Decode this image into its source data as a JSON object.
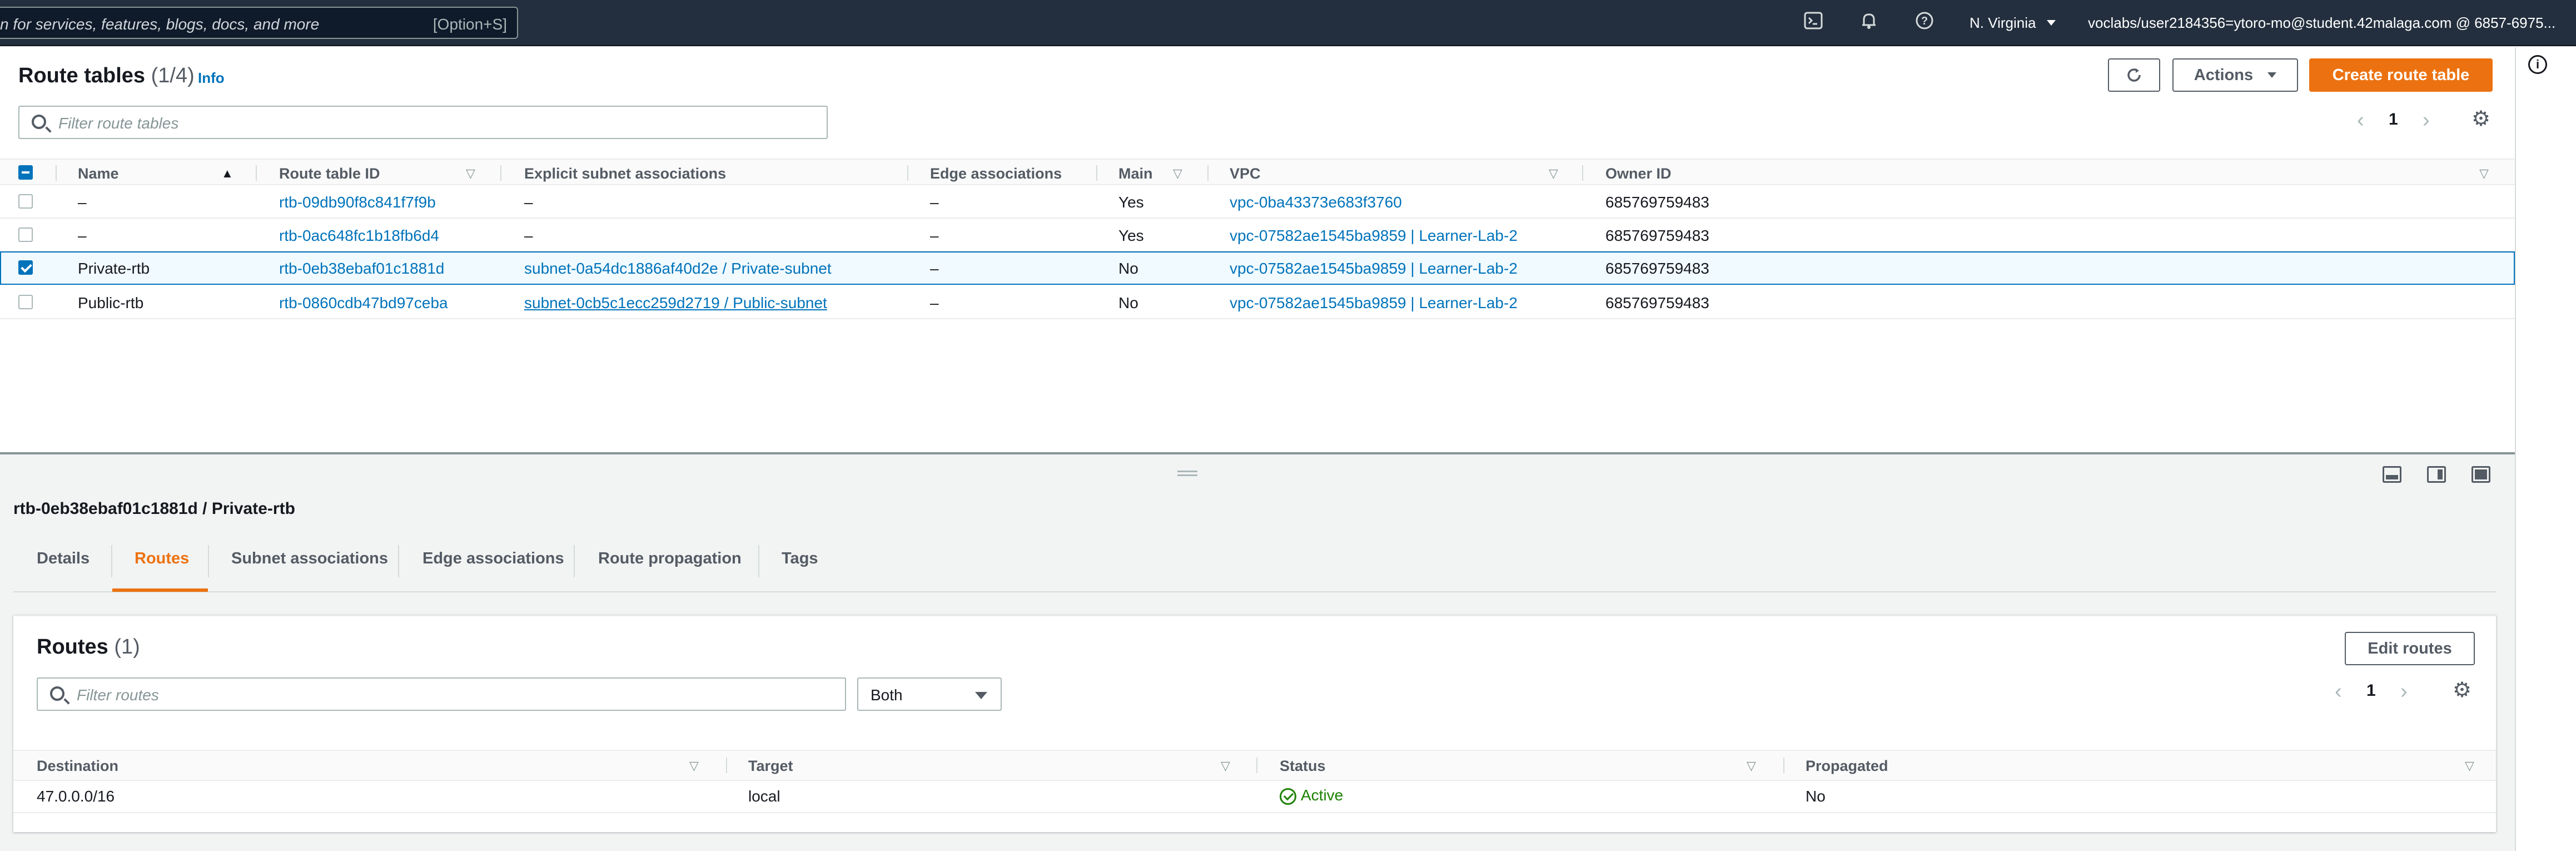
{
  "topbar": {
    "search_placeholder": "n for services, features, blogs, docs, and more",
    "search_shortcut": "[Option+S]",
    "icons": [
      "cloudshell-icon",
      "bell-icon",
      "help-icon"
    ],
    "region": "N. Virginia",
    "account": "voclabs/user2184356=ytoro-mo@student.42malaga.com @ 6857-6975..."
  },
  "route_tables": {
    "title": "Route tables",
    "count": "(1/4)",
    "info": "Info",
    "actions_label": "Actions",
    "create_label": "Create route table",
    "filter_placeholder": "Filter route tables",
    "page": "1",
    "columns": [
      "Name",
      "Route table ID",
      "Explicit subnet associations",
      "Edge associations",
      "Main",
      "VPC",
      "Owner ID"
    ],
    "rows": [
      {
        "checked": false,
        "name": "–",
        "id": "rtb-09db90f8c841f7f9b",
        "subnet": "–",
        "edge": "–",
        "main": "Yes",
        "vpc": "vpc-0ba43373e683f3760",
        "owner": "685769759483"
      },
      {
        "checked": false,
        "name": "–",
        "id": "rtb-0ac648fc1b18fb6d4",
        "subnet": "–",
        "edge": "–",
        "main": "Yes",
        "vpc": "vpc-07582ae1545ba9859 | Learner-Lab-2",
        "owner": "685769759483"
      },
      {
        "checked": true,
        "name": "Private-rtb",
        "id": "rtb-0eb38ebaf01c1881d",
        "subnet": "subnet-0a54dc1886af40d2e / Private-subnet",
        "edge": "–",
        "main": "No",
        "vpc": "vpc-07582ae1545ba9859 | Learner-Lab-2",
        "owner": "685769759483"
      },
      {
        "checked": false,
        "name": "Public-rtb",
        "id": "rtb-0860cdb47bd97ceba",
        "subnet": "subnet-0cb5c1ecc259d2719 / Public-subnet",
        "edge": "–",
        "main": "No",
        "vpc": "vpc-07582ae1545ba9859 | Learner-Lab-2",
        "owner": "685769759483"
      }
    ]
  },
  "detail": {
    "title": "rtb-0eb38ebaf01c1881d / Private-rtb",
    "tabs": [
      "Details",
      "Routes",
      "Subnet associations",
      "Edge associations",
      "Route propagation",
      "Tags"
    ],
    "active_tab": "Routes"
  },
  "routes": {
    "title": "Routes",
    "count": "(1)",
    "edit_label": "Edit routes",
    "filter_placeholder": "Filter routes",
    "select_value": "Both",
    "page": "1",
    "columns": [
      "Destination",
      "Target",
      "Status",
      "Propagated"
    ],
    "rows": [
      {
        "destination": "47.0.0.0/16",
        "target": "local",
        "status": "Active",
        "propagated": "No"
      }
    ]
  },
  "colors": {
    "accent": "#ec7211",
    "link": "#0073bb",
    "success": "#1d8102",
    "topbar": "#232f3e"
  }
}
